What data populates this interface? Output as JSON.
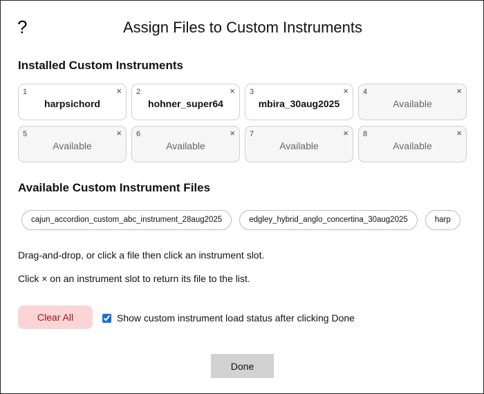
{
  "dialog": {
    "help_label": "?",
    "title": "Assign Files to Custom Instruments"
  },
  "installed": {
    "heading": "Installed Custom Instruments",
    "remove_glyph": "×",
    "slots": [
      {
        "number": "1",
        "name": "harpsichord",
        "state": "filled"
      },
      {
        "number": "2",
        "name": "hohner_super64",
        "state": "filled"
      },
      {
        "number": "3",
        "name": "mbira_30aug2025",
        "state": "filled"
      },
      {
        "number": "4",
        "name": "Available",
        "state": "empty"
      },
      {
        "number": "5",
        "name": "Available",
        "state": "empty"
      },
      {
        "number": "6",
        "name": "Available",
        "state": "empty"
      },
      {
        "number": "7",
        "name": "Available",
        "state": "empty"
      },
      {
        "number": "8",
        "name": "Available",
        "state": "empty"
      }
    ]
  },
  "available": {
    "heading": "Available Custom Instrument Files",
    "files": [
      "cajun_accordion_custom_abc_instrument_28aug2025",
      "edgley_hybrid_anglo_concertina_30aug2025",
      "harp"
    ]
  },
  "instructions": {
    "line1": "Drag-and-drop, or click a file then click an instrument slot.",
    "line2": "Click × on an instrument slot to return its file to the list."
  },
  "controls": {
    "clear_all_label": "Clear All",
    "show_status_label": "Show custom instrument load status after clicking Done",
    "show_status_checked": true,
    "done_label": "Done"
  },
  "colors": {
    "clear_bg": "#fbd5d6",
    "clear_text": "#a0141c",
    "done_bg": "#d2d2d2",
    "checkbox_accent": "#1a6ed8"
  }
}
